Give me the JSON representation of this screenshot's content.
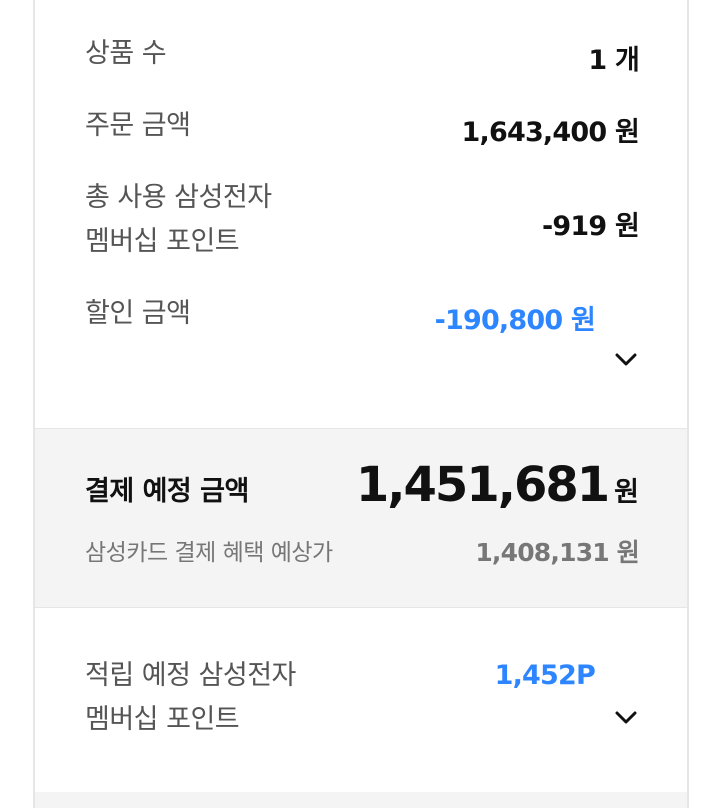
{
  "summary": {
    "product_count_label": "상품 수",
    "product_count_value": "1 개",
    "order_amount_label": "주문 금액",
    "order_amount_value": "1,643,400 원",
    "points_used_label_1": "총 사용 삼성전자",
    "points_used_label_2": "멤버십 포인트",
    "points_used_value": "-919 원",
    "discount_label": "할인 금액",
    "discount_value": "-190,800 원"
  },
  "payment": {
    "label": "결제 예정 금액",
    "amount": "1,451,681",
    "unit": "원",
    "card_label": "삼성카드 결제 혜택 예상가",
    "card_value": "1,408,131 원"
  },
  "earn": {
    "label_1": "적립 예정 삼성전자",
    "label_2": "멤버십 포인트",
    "value": "1,452P"
  },
  "colors": {
    "accent_blue": "#2d86ff",
    "panel_gray": "#f4f4f4"
  },
  "icons": [
    "chevron-down-icon"
  ]
}
